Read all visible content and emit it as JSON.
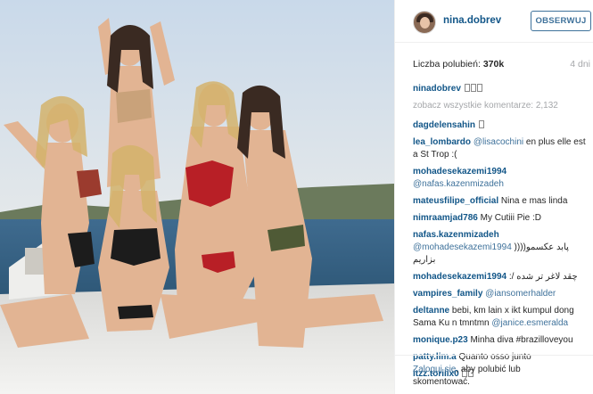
{
  "header": {
    "username": "nina.dobrev",
    "follow_label": "OBSERWUJ"
  },
  "meta": {
    "likes_label": "Liczba polubień:",
    "likes_count": "370k",
    "time_ago": "4 dni"
  },
  "caption": {
    "username": "ninadobrev",
    "text": ""
  },
  "view_all": "zobacz wszystkie komentarze: 2,132",
  "comments": [
    {
      "user": "dagdelensahin",
      "mention": "",
      "text": ""
    },
    {
      "user": "lea_lombardo",
      "mention": "@lisacochini",
      "text": " en plus elle est a St Trop :("
    },
    {
      "user": "mohadesekazemi1994",
      "mention": "@nafas.kazenmizadeh",
      "text": ""
    },
    {
      "user": "mateusfilipe_official",
      "mention": "",
      "text": "Nina e mas linda"
    },
    {
      "user": "nimraamjad786",
      "mention": "",
      "text": "My Cutiii Pie :D"
    },
    {
      "user": "nafas.kazenmizadeh",
      "mention": "@mohadesekazemi1994",
      "text": " ))))پابد عکسمو بزاریم"
    },
    {
      "user": "mohadesekazemi1994",
      "mention": "",
      "text": " :/ چقد لاغر تر شده"
    },
    {
      "user": "vampires_family",
      "mention": "@iansomerhalder",
      "text": ""
    },
    {
      "user": "deltanne",
      "mention": "@janice.esmeralda",
      "text_before": " bebi, km lain x ikt kumpul dong Sama Ku n tmntmn "
    },
    {
      "user": "monique.p23",
      "mention": "",
      "text": " Minha diva #brazilloveyou"
    },
    {
      "user": "patty.lim.a",
      "mention": "",
      "text": " Quanto osso junto"
    },
    {
      "user": "itzz.toriiix0",
      "mention": "",
      "text": ""
    }
  ],
  "footer": {
    "login_link": "Zaloguj się",
    "login_text": ", aby polubić lub skomentować."
  },
  "colors": {
    "username": "#125688",
    "mention": "#3f729b",
    "follow_border": "#3f729b",
    "muted": "#a5a7aa"
  }
}
